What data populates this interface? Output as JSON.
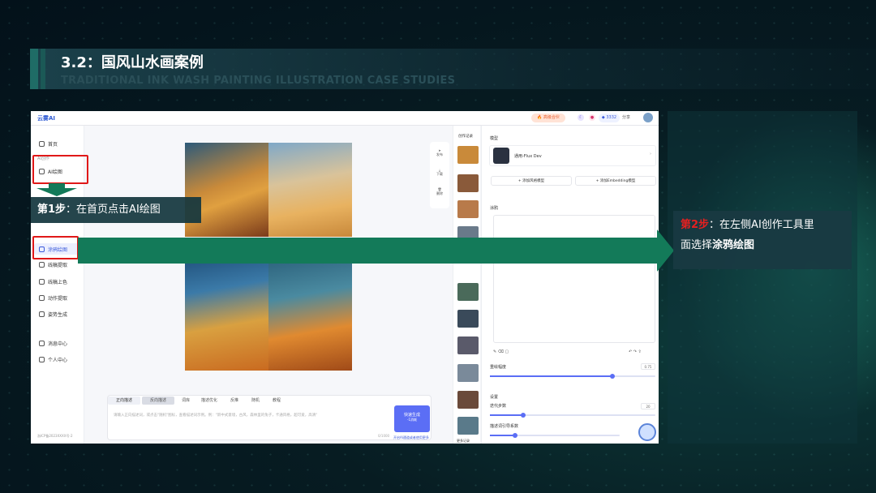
{
  "slide": {
    "title": "3.2：国风山水画案例",
    "subtitle": "TRADITIONAL INK WASH PAINTING ILLUSTRATION CASE STUDIES"
  },
  "app": {
    "logo": "云雾AI",
    "top": {
      "vip": "🔥 高级合伙",
      "points": "◆ 3332",
      "share": "分享"
    },
    "sidebar": {
      "home": "首页",
      "category_ai": "AI创作",
      "ai_draw": "AI绘图",
      "graffiti": "涂鸦绘图",
      "lineart": "线稿提取",
      "coloring": "线稿上色",
      "motion": "动作提取",
      "pose": "姿势生成",
      "messages": "消息中心",
      "profile": "个人中心",
      "footer": "浙ICP备2023XXXX号-2"
    },
    "prompt": {
      "tab_positive": "正向描述",
      "tab_negative": "反向描述",
      "tools": [
        "词库",
        "描述优化",
        "反推",
        "随机",
        "教程"
      ],
      "placeholder": "请输入正向描述词，或点击\"随机\"图标，查看描述词示例。例：\"新中式意境，古风，森林里的兔子，卡通风格，超可爱，高清\"",
      "counter": "0/1000",
      "generate": "快速生成",
      "generate_cost": "-1消耗",
      "note": "开启AI通道或者使用更多"
    },
    "right_tools": [
      "发布",
      "下载",
      "删除"
    ],
    "history": {
      "title": "创作记录",
      "footer": "更多记录",
      "tag": "AI绘图"
    },
    "config": {
      "model_label": "模型",
      "model_name": "通用-Flux Dev",
      "model_tag": "Flux",
      "add_style": "+ 添加风格模型",
      "add_embedding": "+ 添加Embedding模型",
      "graffiti_label": "涂鸦",
      "strength_label": "重绘幅度",
      "strength_value": "0.75",
      "settings_label": "设置",
      "steps_label": "迭代步数",
      "steps_value": "20",
      "guidance_label": "描述词引导系数"
    }
  },
  "annotations": {
    "step1_label": "第1步",
    "step1_text": "：在首页点击AI绘图",
    "step2_label": "第2步",
    "step2_text1": "：在左侧AI创作工具里",
    "step2_text2": "面选择",
    "step2_bold": "涂鸦绘图"
  },
  "colors": {
    "accent": "#137a59",
    "highlight": "#e01818",
    "brand": "#5b6ef5"
  }
}
